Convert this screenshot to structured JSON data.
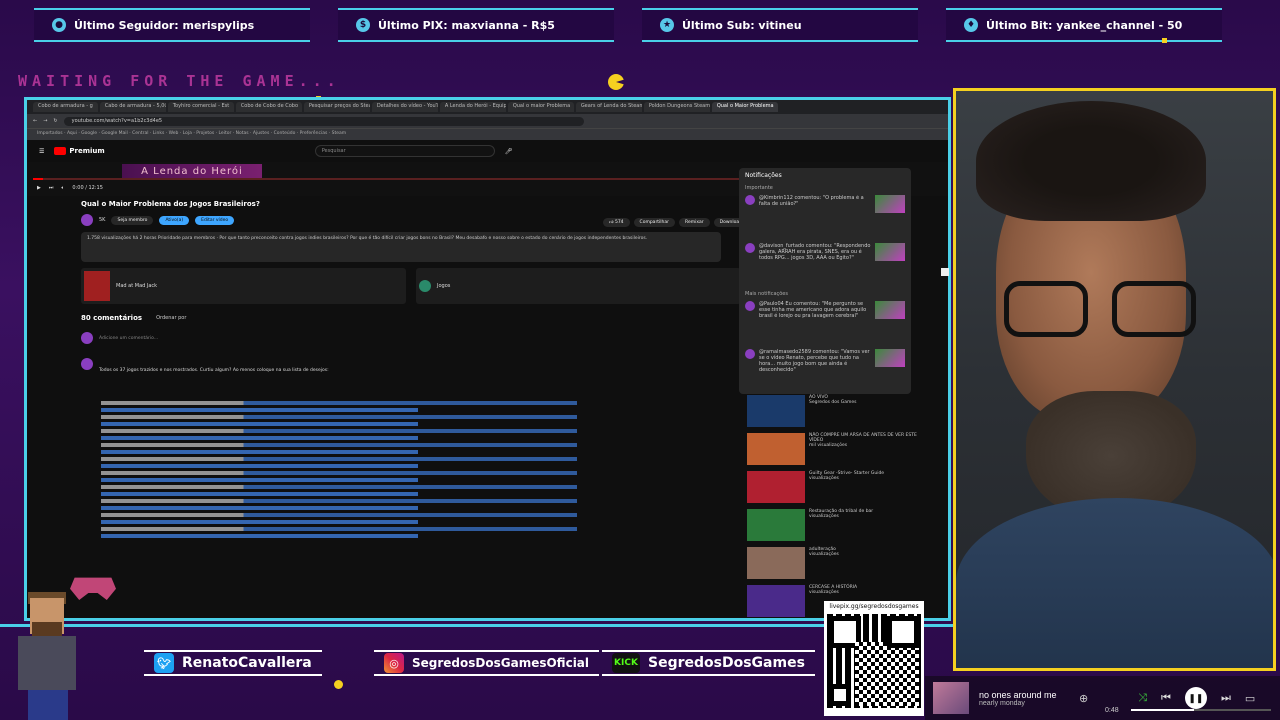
{
  "alerts": [
    {
      "label": "Último Seguidor: merispylips",
      "icon": "user-icon"
    },
    {
      "label": "Último PIX: maxvianna - R$5",
      "icon": "dollar-icon"
    },
    {
      "label": "Último Sub: vitineu",
      "icon": "star-icon"
    },
    {
      "label": "Último Bit: yankee_channel - 50",
      "icon": "diamond-icon"
    }
  ],
  "waiting_text": "WAITING FOR THE GAME...",
  "browser": {
    "tabs": [
      "Cobo de armadura - g",
      "Cabo de armadura - 5,00",
      "Toyhiro comercial - Est",
      "Cobo de Cobo de Cobo",
      "Pesquisar preços do Steam",
      "Detalhes do vídeo - YouT",
      "A Lenda do Herói - Equip",
      "Qual o maior Problema",
      "Gears of Lenda do Steam",
      "Poldon Dungeons Steam",
      "Qual o Maior Problema"
    ],
    "address": "youtube.com/watch?v=a1b2c3d4e5",
    "bookmarks": "Importados · Aqui · Google · Google Mail · Central · Links · Web · Loja · Projetos · Leitor · Notas · Ajustes · Conteúdo · Preferências · Steam"
  },
  "youtube": {
    "logo": "Premium",
    "search_placeholder": "Pesquisar",
    "banner": "A Lenda do Herói",
    "time": "0:00 / 12:15",
    "title": "Qual o Maior Problema dos Jogos Brasileiros?",
    "channel_subs": "5K",
    "buttons": {
      "join": "Seja membro",
      "subscribed": "Ativo(a)",
      "edit": "Editar vídeo"
    },
    "actions": {
      "likes": "574",
      "share": "Compartilhar",
      "remix": "Remixar",
      "download": "Download"
    },
    "description": "1.758 visualizações  há 2 horas  Prioridade para membros · Por que tanto preconceito contra jogos indies brasileiros? Por que é tão difícil criar jogos bons no Brasil? Meu desabafo e nosso sobre o estado do cenário de jogos independentes brasileiros.",
    "card_game": "Mad at Mad Jack",
    "card_jogos": "Jogos",
    "comments_count": "80 comentários",
    "sort_label": "Ordenar por",
    "add_comment": "Adicione um comentário...",
    "pinned_intro": "Todos os 37 jogos trazidos e nos mostrados. Curtiu algum? Ao menos coloque na sua lista de desejos:"
  },
  "notifications": {
    "title": "Notificações",
    "important": "Importante",
    "more": "Mais notificações",
    "items": [
      "@Kimbrin112 comentou: \"O problema é a falta de união?\"",
      "@davison_furtado comentou: \"Respondendo galera, ARRAH era pirata, SNES, era ou é todos RPG... jogos 3D, AAA ou Egito?\"",
      "@Paulo04 Eu comentou: \"Me pergunto se esse tinha me americano que adora aquilo brasil é lorejo ou pra lavagem cerebral\"",
      "@ramalmasedo2589 comentou: \"Vamos ver se o vídeo Renato, percebe que tudo na hora... muito jogo bom que ainda é desconhecido\""
    ]
  },
  "recommended": [
    {
      "title": "AO VIVO",
      "meta": "Segredos dos Games"
    },
    {
      "title": "NÃO COMPRE UM ARSA DE ANTES DE VER ESTE VÍDEO",
      "meta": "mil visualizações"
    },
    {
      "title": "Guilty Gear -Strive- Starter Guide",
      "meta": "visualizações"
    },
    {
      "title": "Restauração da tribal de bar",
      "meta": "visualizações"
    },
    {
      "title": "adulteração",
      "meta": "visualizações"
    },
    {
      "title": "CERCASE A HISTÓRIA",
      "meta": "visualizações"
    }
  ],
  "social": {
    "twitter": "RenatoCavallera",
    "instagram": "SegredosDosGamesOficial",
    "kick_label": "KICK",
    "kick": "SegredosDosGames"
  },
  "qr_url": "livepix.gg/segredosdosgames",
  "music": {
    "title": "no ones around me",
    "artist": "nearly monday",
    "time": "0:48",
    "progress": 0.45
  },
  "colors": {
    "accent": "#4ad0e8",
    "webcam_border": "#f5d020",
    "background": "#2a0a4a"
  }
}
